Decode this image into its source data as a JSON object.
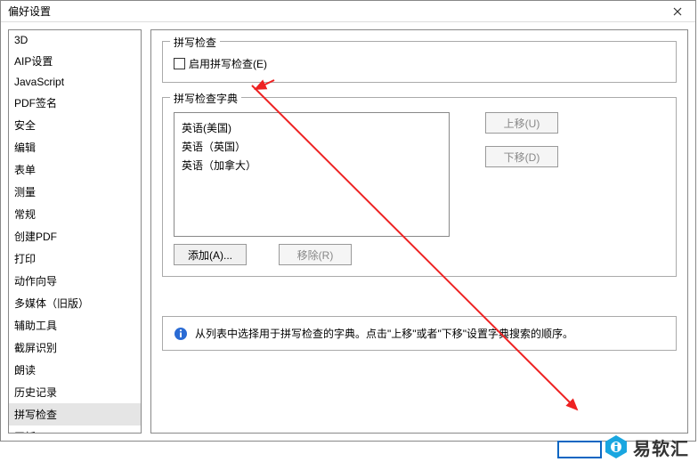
{
  "window": {
    "title": "偏好设置"
  },
  "sidebar": {
    "items": [
      {
        "label": "3D"
      },
      {
        "label": "AIP设置"
      },
      {
        "label": "JavaScript"
      },
      {
        "label": "PDF签名"
      },
      {
        "label": "安全"
      },
      {
        "label": "编辑"
      },
      {
        "label": "表单"
      },
      {
        "label": "测量"
      },
      {
        "label": "常规"
      },
      {
        "label": "创建PDF"
      },
      {
        "label": "打印"
      },
      {
        "label": "动作向导"
      },
      {
        "label": "多媒体（旧版）"
      },
      {
        "label": "辅助工具"
      },
      {
        "label": "截屏识别"
      },
      {
        "label": "朗读"
      },
      {
        "label": "历史记录"
      },
      {
        "label": "拼写检查"
      },
      {
        "label": "平板"
      }
    ],
    "selectedIndex": 17
  },
  "group_spellcheck": {
    "label": "拼写检查",
    "checkbox_label": "启用拼写检查(E)"
  },
  "group_dict": {
    "label": "拼写检查字典",
    "list": [
      {
        "label": "英语(美国)"
      },
      {
        "label": "英语（英国）"
      },
      {
        "label": "英语（加拿大）"
      }
    ],
    "btn_up": "上移(U)",
    "btn_down": "下移(D)",
    "btn_add": "添加(A)...",
    "btn_remove": "移除(R)"
  },
  "info": {
    "text": "从列表中选择用于拼写检查的字典。点击\"上移\"或者\"下移\"设置字典搜索的顺序。"
  },
  "brand": {
    "text": "易软汇"
  }
}
